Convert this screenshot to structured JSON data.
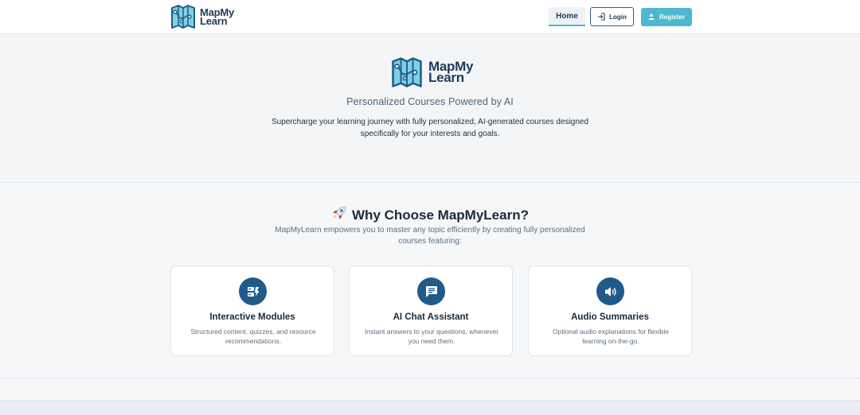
{
  "nav": {
    "brand_line1": "MapMy",
    "brand_line2": "Learn",
    "home_label": "Home",
    "login_label": "Login",
    "register_label": "Register"
  },
  "hero": {
    "logo_line1": "MapMy",
    "logo_line2": "Learn",
    "subtitle": "Personalized Courses Powered by AI",
    "description": "Supercharge your learning journey with fully personalized, AI-generated courses designed specifically for your interests and goals."
  },
  "why": {
    "title": "Why Choose MapMyLearn?",
    "description": "MapMyLearn empowers you to master any topic efficiently by creating fully personalized courses featuring:",
    "features": [
      {
        "icon": "modules-icon",
        "title": "Interactive Modules",
        "description": "Structured content, quizzes, and resource recommendations."
      },
      {
        "icon": "chat-icon",
        "title": "AI Chat Assistant",
        "description": "Instant answers to your questions, whenever you need them."
      },
      {
        "icon": "speaker-icon",
        "title": "Audio Summaries",
        "description": "Optional audio explanations for flexible learning on-the-go."
      }
    ]
  },
  "colors": {
    "accent": "#4db8d0",
    "brand": "#1f3b57",
    "icon_circle": "#1f5a8a"
  }
}
